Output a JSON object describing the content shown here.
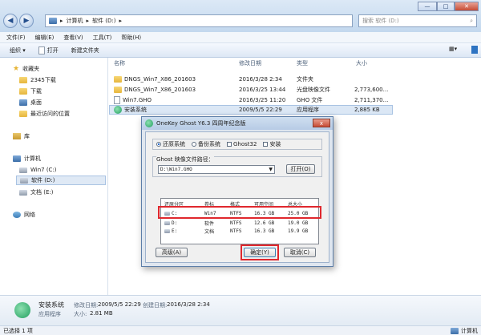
{
  "address": {
    "parts": [
      "计算机",
      "软件 (D:)"
    ]
  },
  "search": {
    "placeholder": "搜索 软件 (D:)"
  },
  "menu": [
    "文件(F)",
    "编辑(E)",
    "查看(V)",
    "工具(T)",
    "帮助(H)"
  ],
  "toolbar": {
    "organize": "组织",
    "open": "打开",
    "new_folder": "新建文件夹"
  },
  "sidebar": {
    "favorites": "收藏夹",
    "fav_items": [
      "2345下载",
      "下载",
      "桌面",
      "最近访问的位置"
    ],
    "library": "库",
    "computer": "计算机",
    "drives": [
      "Win7 (C:)",
      "软件 (D:)",
      "文档 (E:)"
    ],
    "network": "网络"
  },
  "columns": {
    "name": "名称",
    "modified": "修改日期",
    "type": "类型",
    "size": "大小"
  },
  "files": [
    {
      "name": "DNGS_Win7_X86_201603",
      "modified": "2016/3/28 2:34",
      "type": "文件夹",
      "size": "",
      "icon": "folder-icon"
    },
    {
      "name": "DNGS_Win7_X86_201603",
      "modified": "2016/3/25 13:44",
      "type": "光盘映像文件",
      "size": "2,773,600...",
      "icon": "disc-image-icon"
    },
    {
      "name": "Win7.GHO",
      "modified": "2016/3/25 11:20",
      "type": "GHO 文件",
      "size": "2,711,370...",
      "icon": "file-icon"
    },
    {
      "name": "安装系统",
      "modified": "2009/5/5 22:29",
      "type": "应用程序",
      "size": "2,885 KB",
      "icon": "ghost-app-icon"
    }
  ],
  "dialog": {
    "title": "OneKey Ghost Y6.3 四周年纪念版",
    "close": "x",
    "restore": "还原系统",
    "backup": "备份系统",
    "ghost32": "Ghost32",
    "install": "安装",
    "path_label": "Ghost 映像文件路径：",
    "path_value": "D:\\Win7.GHO",
    "open": "打开(O)",
    "table_headers": [
      "还原分区",
      "卷标",
      "格式",
      "可用空间",
      "总大小"
    ],
    "partitions": [
      [
        "C:",
        "Win7",
        "NTFS",
        "16.3 GB",
        "25.0 GB"
      ],
      [
        "D:",
        "软件",
        "NTFS",
        "12.6 GB",
        "19.0 GB"
      ],
      [
        "E:",
        "文档",
        "NTFS",
        "16.3 GB",
        "19.9 GB"
      ]
    ],
    "advanced": "高级(A)",
    "ok": "确定(Y)",
    "cancel": "取消(C)"
  },
  "details": {
    "name": "安装系统",
    "modified_label": "修改日期:",
    "modified": "2009/5/5 22:29",
    "created_label": "创建日期:",
    "created": "2016/3/28 2:34",
    "type": "应用程序",
    "size_label": "大小:",
    "size": "2.81 MB"
  },
  "status": {
    "selected": "已选择 1 项",
    "location": "计算机"
  }
}
